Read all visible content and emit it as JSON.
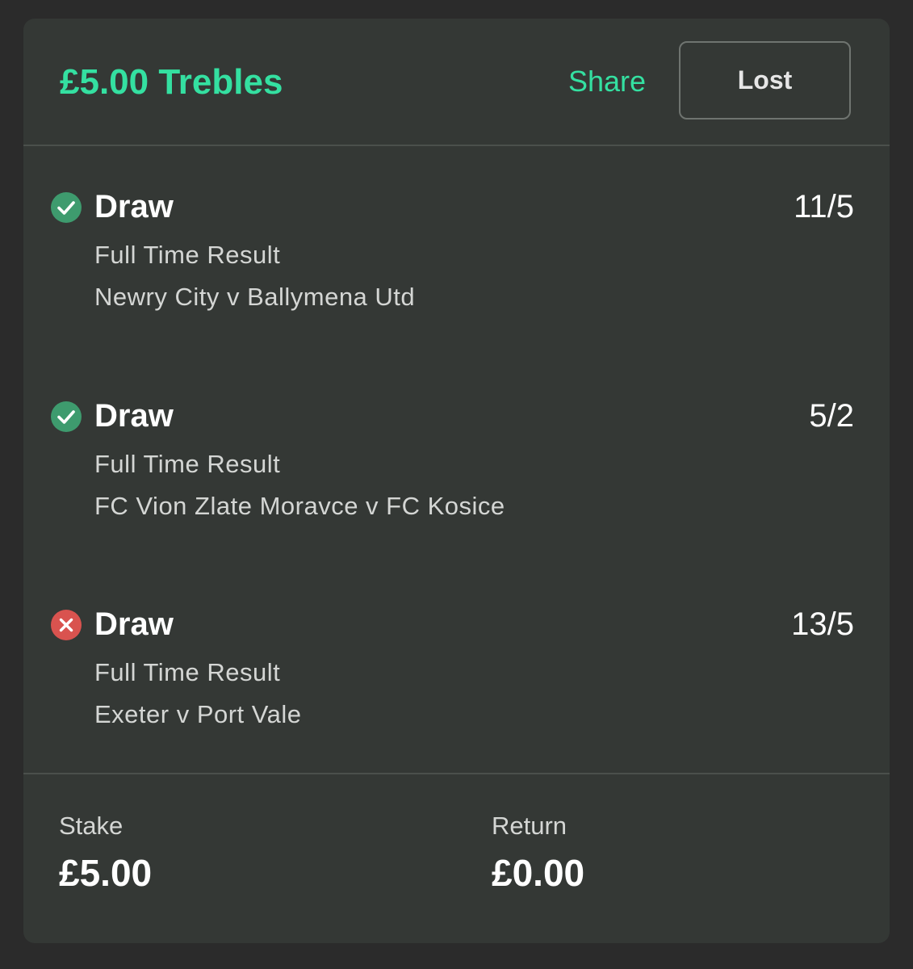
{
  "bet": {
    "title": "£5.00 Trebles",
    "share_label": "Share",
    "status_label": "Lost"
  },
  "colors": {
    "accent": "#34e0a1",
    "won": "#3e9b6e",
    "lost": "#d9534f",
    "card_background": "#343835"
  },
  "selections": [
    {
      "name": "Draw",
      "odds": "11/5",
      "market": "Full Time Result",
      "event": "Newry City v Ballymena Utd",
      "result_icon": "check-circle-icon"
    },
    {
      "name": "Draw",
      "odds": "5/2",
      "market": "Full Time Result",
      "event": "FC Vion Zlate Moravce v FC Kosice",
      "result_icon": "check-circle-icon"
    },
    {
      "name": "Draw",
      "odds": "13/5",
      "market": "Full Time Result",
      "event": "Exeter v Port Vale",
      "result_icon": "cross-circle-icon"
    }
  ],
  "footer": {
    "stake_label": "Stake",
    "stake_value": "£5.00",
    "return_label": "Return",
    "return_value": "£0.00"
  }
}
